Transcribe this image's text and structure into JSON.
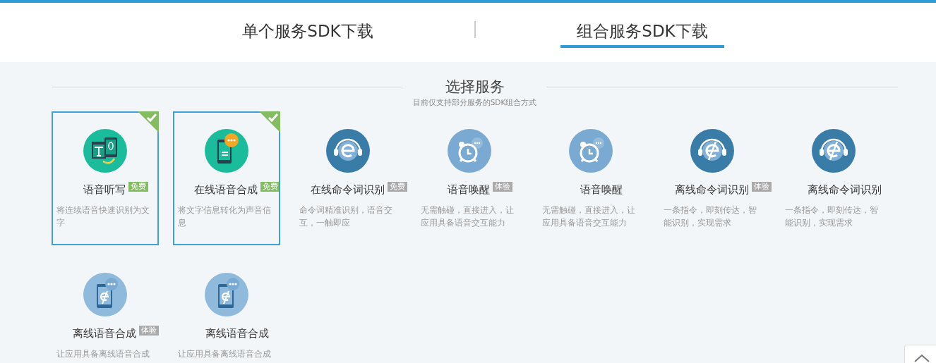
{
  "tabs": [
    {
      "label": "单个服务SDK下载",
      "selected": false
    },
    {
      "label": "组合服务SDK下载",
      "selected": true
    }
  ],
  "section": {
    "title": "选择服务",
    "subtitle": "目前仅支持部分服务的SDK组合方式"
  },
  "services": [
    {
      "name": "语音听写",
      "kind": "text-phone",
      "color": "#1bbc9b",
      "selected": true,
      "badge": {
        "text": "免费",
        "kind": "free"
      },
      "description": "将连续语音快速识别为文字"
    },
    {
      "name": "在线语音合成",
      "kind": "phone-chat",
      "color": "#1bbc9b",
      "selected": true,
      "badge": {
        "text": "免费",
        "kind": "free"
      },
      "description": "将文字信息转化为声音信息"
    },
    {
      "name": "在线命令词识别",
      "kind": "headset-e",
      "color": "#3a7ca8",
      "selected": false,
      "badge": {
        "text": "免费",
        "kind": "trial"
      },
      "description": "命令词精准识别，语音交互，一触即应"
    },
    {
      "name": "语音唤醒",
      "kind": "alarm",
      "color": "#7aaad2",
      "selected": false,
      "badge": {
        "text": "体验",
        "kind": "trial"
      },
      "description": "无需触碰，直接进入，让应用具备语音交互能力"
    },
    {
      "name": "语音唤醒",
      "kind": "alarm",
      "color": "#7aaad2",
      "selected": false,
      "description": "无需触碰，直接进入，让应用具备语音交互能力"
    },
    {
      "name": "离线命令词识别",
      "kind": "headset-slash",
      "color": "#3a7ca8",
      "selected": false,
      "badge": {
        "text": "体验",
        "kind": "trial"
      },
      "description": "一条指令，即刻传达，智能识别，实现需求"
    },
    {
      "name": "离线命令词识别",
      "kind": "headset-slash",
      "color": "#3a7ca8",
      "selected": false,
      "description": "一条指令，即刻传达，智能识别，实现需求"
    },
    {
      "name": "离线语音合成",
      "kind": "phone-slash",
      "color": "#8fbadc",
      "selected": false,
      "badge": {
        "text": "体验",
        "kind": "trial"
      },
      "description": "让应用具备离线语音合成"
    },
    {
      "name": "离线语音合成",
      "kind": "phone-slash",
      "color": "#8fbadc",
      "selected": false,
      "description": "让应用具备离线语音合成"
    }
  ]
}
